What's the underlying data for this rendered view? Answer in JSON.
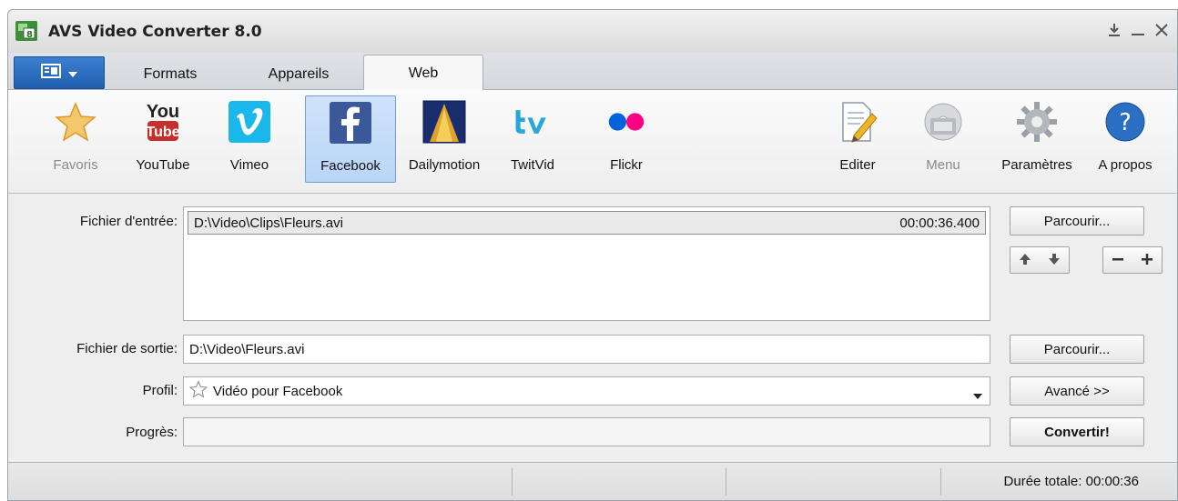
{
  "window": {
    "title": "AVS Video Converter 8.0"
  },
  "tabs": [
    {
      "label": "Formats"
    },
    {
      "label": "Appareils"
    },
    {
      "label": "Web"
    }
  ],
  "ribbon": {
    "favoris": "Favoris",
    "youtube": "YouTube",
    "youtube_logo_top": "You",
    "youtube_logo_bottom": "Tube",
    "vimeo": "Vimeo",
    "facebook": "Facebook",
    "dailymotion": "Dailymotion",
    "twitvid": "TwitVid",
    "flickr": "Flickr",
    "editer": "Editer",
    "menu": "Menu",
    "parametres": "Paramètres",
    "apropos": "A propos"
  },
  "form": {
    "input_label": "Fichier d'entrée:",
    "input_file": "D:\\Video\\Clips\\Fleurs.avi",
    "input_duration": "00:00:36.400",
    "output_label": "Fichier de sortie:",
    "output_value": "D:\\Video\\Fleurs.avi",
    "profile_label": "Profil:",
    "profile_value": "Vidéo pour Facebook",
    "progress_label": "Progrès:",
    "progress_value": 0
  },
  "buttons": {
    "browse_input": "Parcourir...",
    "browse_output": "Parcourir...",
    "advanced": "Avancé >>",
    "convert": "Convertir!"
  },
  "status": {
    "total_duration": "Durée totale: 00:00:36"
  },
  "colors": {
    "accent": "#2a6fc4",
    "selected_bg": "#c6ddf8",
    "youtube_red": "#c4302b",
    "vimeo_blue": "#1ab7ea",
    "facebook_blue": "#3b5998",
    "flickr_blue": "#0063dc",
    "flickr_pink": "#ff0084",
    "twitvid_cyan": "#25a7d9"
  }
}
